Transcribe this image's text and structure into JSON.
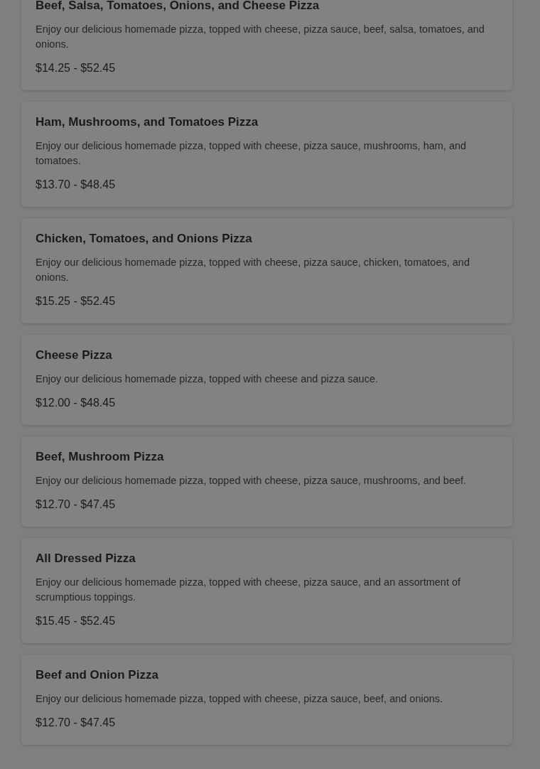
{
  "menu_items": [
    {
      "name": "Beef, Salsa, Tomatoes, Onions, and Cheese Pizza",
      "description": "Enjoy our delicious homemade pizza, topped with cheese, pizza sauce, beef, salsa, tomatoes, and onions.",
      "price": "$14.25 - $52.45"
    },
    {
      "name": "Ham, Mushrooms, and Tomatoes Pizza",
      "description": "Enjoy our delicious homemade pizza, topped with cheese, pizza sauce, mushrooms, ham, and tomatoes.",
      "price": "$13.70 - $48.45"
    },
    {
      "name": "Chicken, Tomatoes, and Onions Pizza",
      "description": "Enjoy our delicious homemade pizza, topped with cheese, pizza sauce, chicken, tomatoes, and onions.",
      "price": "$15.25 - $52.45"
    },
    {
      "name": "Cheese Pizza",
      "description": "Enjoy our delicious homemade pizza, topped with cheese and pizza sauce.",
      "price": "$12.00 - $48.45"
    },
    {
      "name": "Beef, Mushroom Pizza",
      "description": "Enjoy our delicious homemade pizza, topped with cheese, pizza sauce, mushrooms, and beef.",
      "price": "$12.70 - $47.45"
    },
    {
      "name": "All Dressed Pizza",
      "description": "Enjoy our delicious homemade pizza, topped with cheese, pizza sauce, and an assortment of scrumptious toppings.",
      "price": "$15.45 - $52.45"
    },
    {
      "name": "Beef and Onion Pizza",
      "description": "Enjoy our delicious homemade pizza, topped with cheese, pizza sauce, beef, and onions.",
      "price": "$12.70 - $47.45"
    }
  ]
}
